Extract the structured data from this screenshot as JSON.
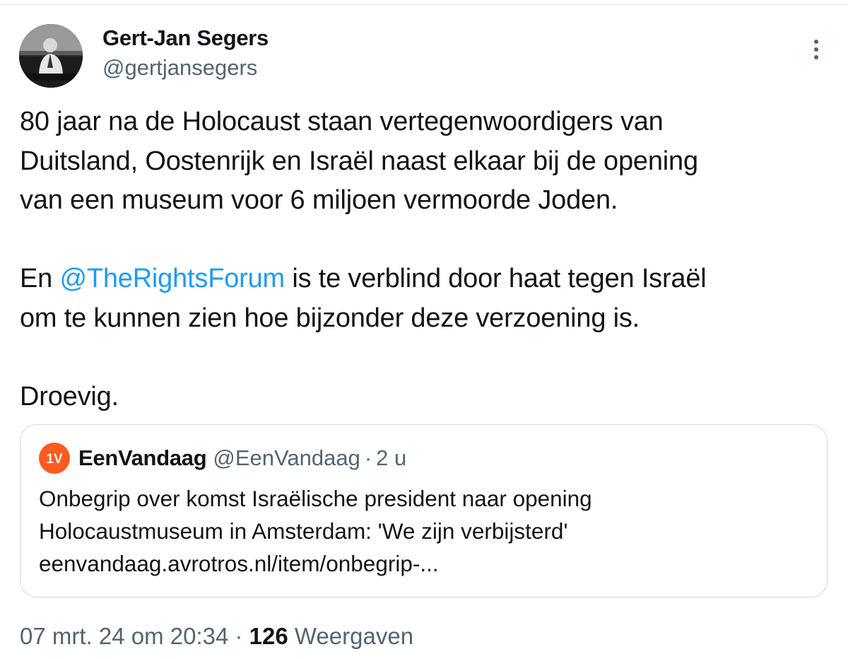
{
  "author": {
    "name": "Gert-Jan Segers",
    "handle": "@gertjansegers"
  },
  "icons": {
    "avatar": "profile-photo",
    "more": "more-options-vertical-dots-icon",
    "quote_logo": "eenvandaag-logo"
  },
  "tweet": {
    "paragraph1_lines": [
      "80 jaar na de Holocaust staan vertegenwoordigers van",
      "Duitsland, Oostenrijk en Israël naast elkaar bij de opening",
      "van een museum voor 6 miljoen vermoorde Joden."
    ],
    "paragraph2_prefix": "En ",
    "mention": "@TheRightsForum",
    "paragraph2_suffix": " is te verblind door haat tegen Israël",
    "paragraph2_line2": "om te kunnen zien hoe bijzonder deze verzoening is.",
    "paragraph3": "Droevig."
  },
  "quote": {
    "logo_text": "1V",
    "name": "EenVandaag",
    "handle": "@EenVandaag",
    "separator": "·",
    "time": "2 u",
    "body_lines": [
      "Onbegrip over komst Israëlische president naar opening",
      "Holocaustmuseum in Amsterdam: 'We zijn verbijsterd'",
      "eenvandaag.avrotros.nl/item/onbegrip-..."
    ]
  },
  "meta": {
    "datetime": "07 mrt. 24 om 20:34",
    "separator": " · ",
    "views_count": "126",
    "views_label": " Weergaven"
  },
  "colors": {
    "text": "#0f1419",
    "secondary": "#536471",
    "link": "#1d9bf0",
    "border": "#cfd9de",
    "quote_logo": "#ff5a1f"
  }
}
